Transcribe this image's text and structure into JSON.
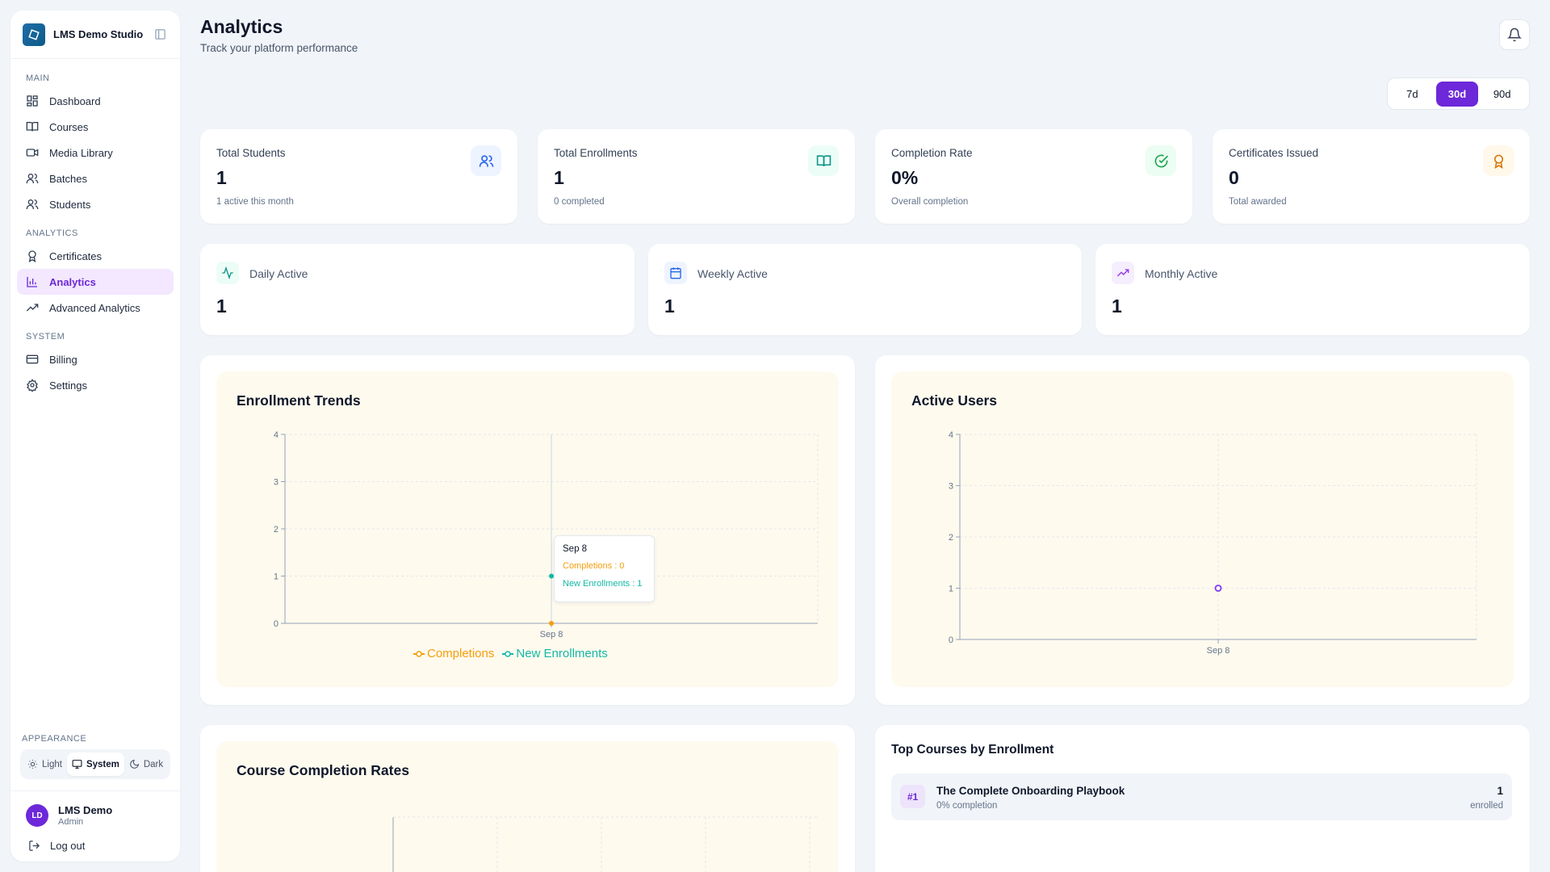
{
  "sidebar": {
    "brand": "LMS Demo Studio",
    "sections": [
      {
        "label": "MAIN",
        "items": [
          {
            "label": "Dashboard",
            "icon": "dashboard-icon"
          },
          {
            "label": "Courses",
            "icon": "book-icon"
          },
          {
            "label": "Media Library",
            "icon": "video-icon"
          },
          {
            "label": "Batches",
            "icon": "users-icon"
          },
          {
            "label": "Students",
            "icon": "users-icon"
          }
        ]
      },
      {
        "label": "ANALYTICS",
        "items": [
          {
            "label": "Certificates",
            "icon": "award-icon"
          },
          {
            "label": "Analytics",
            "icon": "bar-chart-icon",
            "active": true
          },
          {
            "label": "Advanced Analytics",
            "icon": "trending-up-icon"
          }
        ]
      },
      {
        "label": "SYSTEM",
        "items": [
          {
            "label": "Billing",
            "icon": "credit-card-icon"
          },
          {
            "label": "Settings",
            "icon": "gear-icon"
          }
        ]
      }
    ],
    "appearance": {
      "label": "APPEARANCE",
      "options": [
        "Light",
        "System",
        "Dark"
      ],
      "selected": "System"
    },
    "user": {
      "initials": "LD",
      "name": "LMS Demo",
      "role": "Admin"
    },
    "logout_label": "Log out"
  },
  "header": {
    "title": "Analytics",
    "subtitle": "Track your platform performance",
    "ranges": [
      "7d",
      "30d",
      "90d"
    ],
    "selected_range": "30d"
  },
  "stats": [
    {
      "label": "Total Students",
      "value": "1",
      "sub": "1 active this month",
      "icon": "users-icon",
      "color": "#2563eb",
      "bg": "#eef4ff"
    },
    {
      "label": "Total Enrollments",
      "value": "1",
      "sub": "0 completed",
      "icon": "book-open-icon",
      "color": "#0d9488",
      "bg": "#ecfdf7"
    },
    {
      "label": "Completion Rate",
      "value": "0%",
      "sub": "Overall completion",
      "icon": "check-circle-icon",
      "color": "#16a34a",
      "bg": "#ecfdf3"
    },
    {
      "label": "Certificates Issued",
      "value": "0",
      "sub": "Total awarded",
      "icon": "award-icon",
      "color": "#d97706",
      "bg": "#fff8eb"
    }
  ],
  "activity": [
    {
      "label": "Daily Active",
      "value": "1",
      "icon": "activity-icon",
      "color": "#0d9488",
      "bg": "#ecfdf7"
    },
    {
      "label": "Weekly Active",
      "value": "1",
      "icon": "calendar-icon",
      "color": "#2563eb",
      "bg": "#eef4ff"
    },
    {
      "label": "Monthly Active",
      "value": "1",
      "icon": "trending-up-icon",
      "color": "#9333ea",
      "bg": "#f5eefe"
    }
  ],
  "colors": {
    "accent": "#6d28d9",
    "completions": "#f59e0b",
    "enrollments": "#14b8a6",
    "active_users": "#7c3aed"
  },
  "chart_data": [
    {
      "type": "line",
      "title": "Enrollment Trends",
      "x": [
        "Sep 8"
      ],
      "series": [
        {
          "name": "Completions",
          "values": [
            0
          ]
        },
        {
          "name": "New Enrollments",
          "values": [
            1
          ]
        }
      ],
      "ylim": [
        0,
        4
      ],
      "yticks": [
        0,
        1,
        2,
        3,
        4
      ],
      "grid": true,
      "legend": "bottom",
      "tooltip": {
        "title": "Sep 8",
        "rows": [
          "Completions : 0",
          "New Enrollments : 1"
        ]
      }
    },
    {
      "type": "line",
      "title": "Active Users",
      "x": [
        "Sep 8"
      ],
      "series": [
        {
          "values": [
            1
          ]
        }
      ],
      "ylim": [
        0,
        4
      ],
      "yticks": [
        0,
        1,
        2,
        3,
        4
      ],
      "grid": true
    },
    {
      "type": "bar",
      "title": "Course Completion Rates",
      "grid": true
    }
  ],
  "top_courses": {
    "title": "Top Courses by Enrollment",
    "items": [
      {
        "rank": "#1",
        "name": "The Complete Onboarding Playbook",
        "sub": "0% completion",
        "count": "1",
        "count_label": "enrolled"
      }
    ]
  }
}
